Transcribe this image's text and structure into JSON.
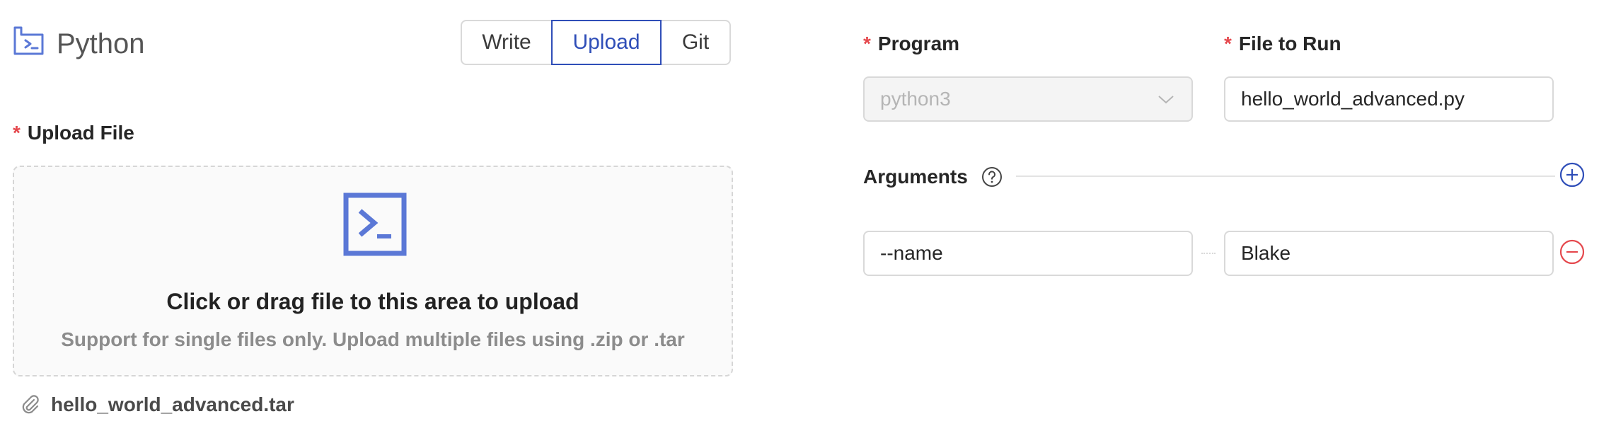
{
  "header": {
    "title": "Python",
    "icon": "python-terminal-icon"
  },
  "mode_switch": {
    "options": [
      "Write",
      "Upload",
      "Git"
    ],
    "selected": "Upload"
  },
  "upload": {
    "required_mark": "*",
    "label": "Upload File",
    "drop_title": "Click or drag file to this area to upload",
    "drop_hint": "Support for single files only. Upload multiple files using .zip or .tar",
    "drop_icon": "terminal-icon",
    "uploaded_file": {
      "name": "hello_world_advanced.tar",
      "icon": "paperclip-icon"
    }
  },
  "program": {
    "required_mark": "*",
    "label": "Program",
    "value": "python3"
  },
  "file_to_run": {
    "required_mark": "*",
    "label": "File to Run",
    "value": "hello_world_advanced.py"
  },
  "arguments": {
    "label": "Arguments",
    "items": [
      {
        "key": "--name",
        "value": "Blake"
      }
    ]
  },
  "colors": {
    "accent": "#2f4eb8",
    "icon_blue": "#5b78d6",
    "required": "#e5484d",
    "remove": "#e5484d"
  }
}
